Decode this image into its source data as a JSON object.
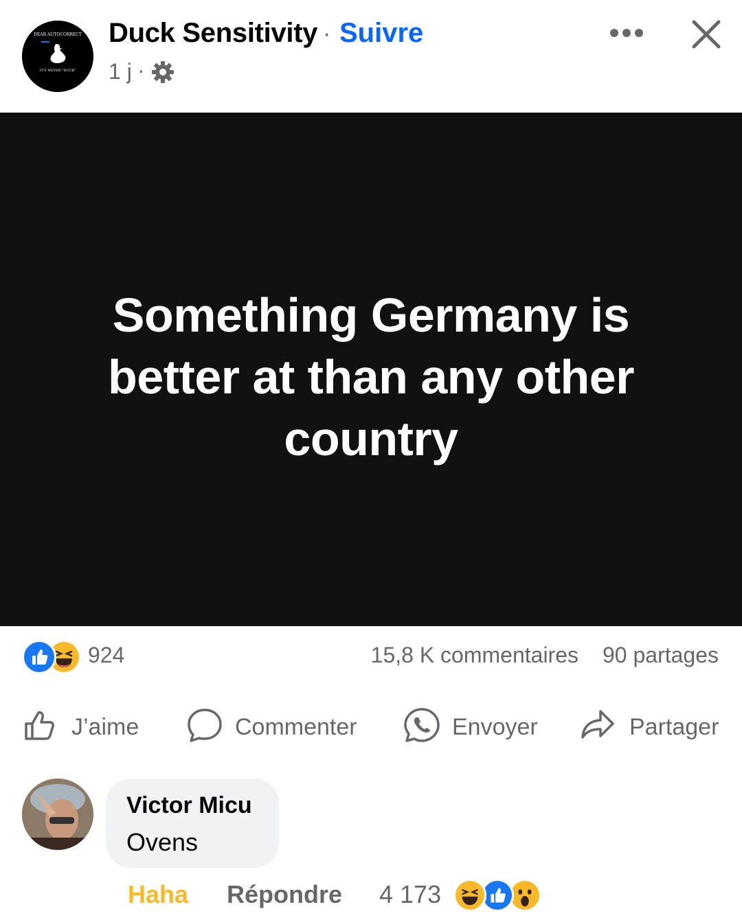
{
  "header": {
    "page_name": "Duck Sensitivity",
    "separator": "·",
    "follow_label": "Suivre",
    "time": "1 j",
    "avatar_text_top": "DEAR AUTOCORRECT",
    "avatar_text_bottom": "IT'S NEVER \"DUCK\"",
    "icons": [
      "gear-icon",
      "more-icon",
      "close-icon"
    ]
  },
  "post": {
    "text": "Something Germany is better at than any other country",
    "background": "#111111"
  },
  "stats": {
    "reaction_count": "924",
    "comments": "15,8 K commentaires",
    "shares": "90 partages"
  },
  "actions": {
    "like": "J’aime",
    "comment": "Commenter",
    "send": "Envoyer",
    "share": "Partager"
  },
  "comment": {
    "author": "Victor Micu",
    "text": "Ovens",
    "reaction_label": "Haha",
    "reply_label": "Répondre",
    "reaction_count": "4 173"
  },
  "colors": {
    "accent": "#0866ff",
    "haha": "#f7b928",
    "secondary_text": "#65676b"
  }
}
